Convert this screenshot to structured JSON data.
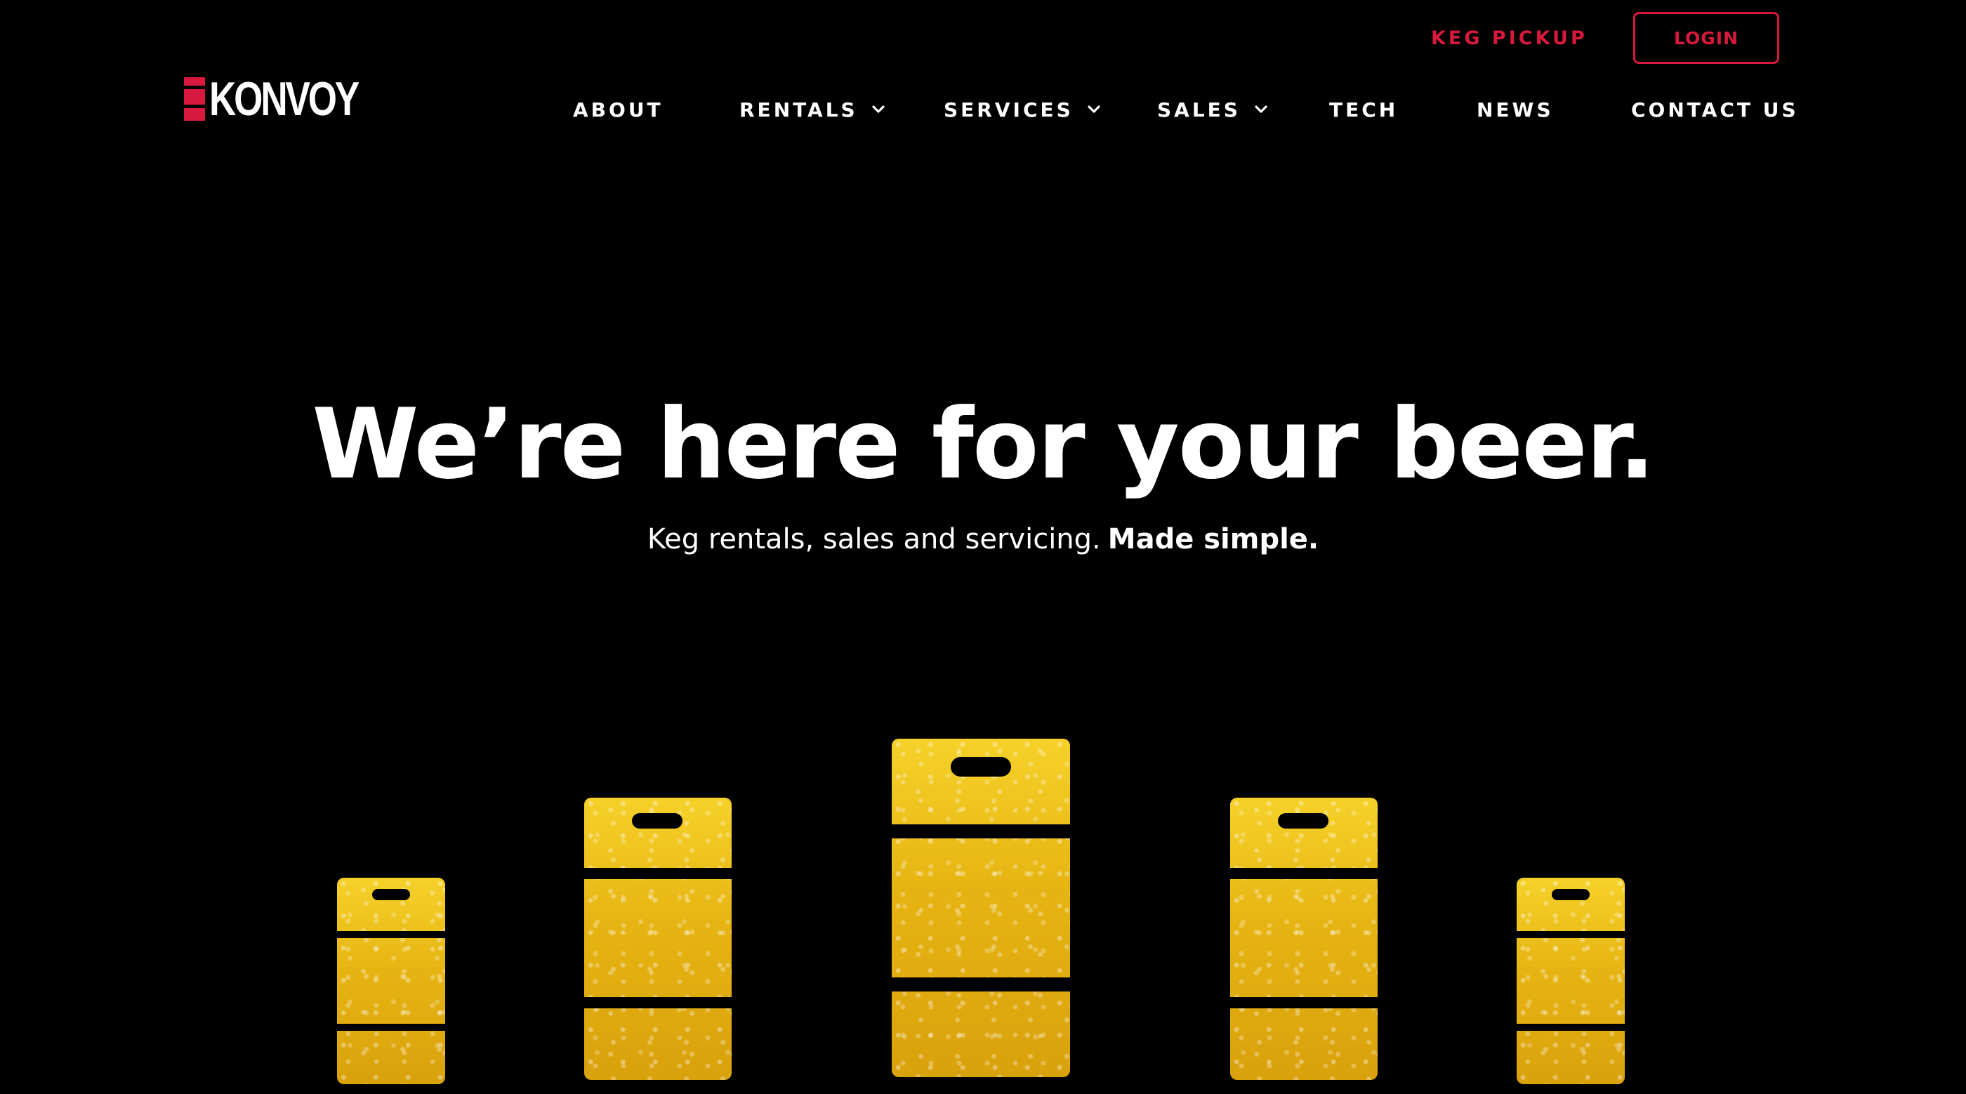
{
  "brand": {
    "logo_text": "KONVOY",
    "accent_color": "#d7193d",
    "background_color": "#000000"
  },
  "utility": {
    "keg_pickup_label": "KEG PICKUP",
    "login_label": "LOGIN"
  },
  "nav": {
    "items": [
      {
        "label": "ABOUT",
        "has_dropdown": false
      },
      {
        "label": "RENTALS",
        "has_dropdown": true
      },
      {
        "label": "SERVICES",
        "has_dropdown": true
      },
      {
        "label": "SALES",
        "has_dropdown": true
      },
      {
        "label": "TECH",
        "has_dropdown": false
      },
      {
        "label": "NEWS",
        "has_dropdown": false
      },
      {
        "label": "CONTACT US",
        "has_dropdown": false
      }
    ],
    "dropdown_icon": "chevron-down-icon"
  },
  "hero": {
    "title": "We’re here for your beer.",
    "subtitle_light": "Keg rentals, sales and servicing.",
    "subtitle_bold": "Made simple."
  },
  "illustration": {
    "description_icon": "keg-icon",
    "keg_color": "#e6b412"
  }
}
